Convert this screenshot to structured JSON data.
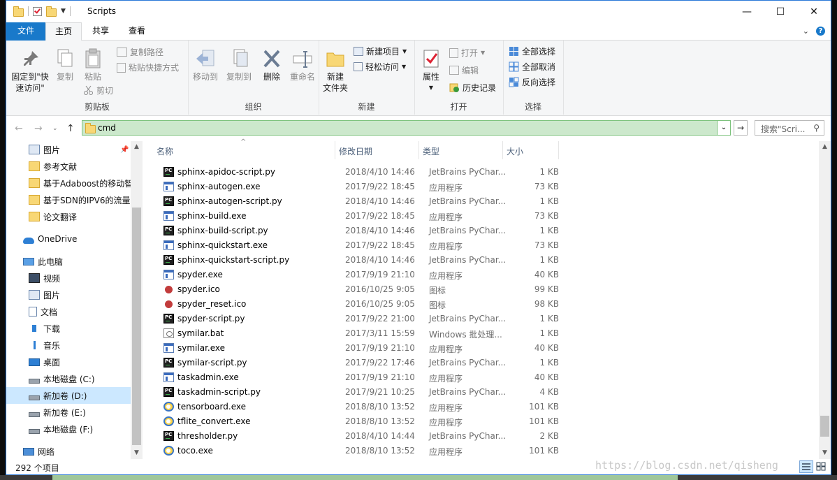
{
  "window": {
    "title": "Scripts",
    "minimize": "—",
    "maximize": "☐",
    "close": "✕"
  },
  "tabs": {
    "file": "文件",
    "home": "主页",
    "share": "共享",
    "view": "查看"
  },
  "ribbon": {
    "clipboard": {
      "name": "剪贴板",
      "pin": "固定到\"快速访问\"",
      "copy": "复制",
      "paste": "粘贴",
      "copy_path": "复制路径",
      "paste_shortcut": "粘贴快捷方式",
      "cut": "剪切"
    },
    "organize": {
      "name": "组织",
      "move_to": "移动到",
      "copy_to": "复制到",
      "delete": "删除",
      "rename": "重命名"
    },
    "new": {
      "name": "新建",
      "new_folder": "新建\n文件夹",
      "new_item": "新建项目",
      "easy_access": "轻松访问"
    },
    "open": {
      "name": "打开",
      "properties": "属性",
      "open": "打开",
      "edit": "编辑",
      "history": "历史记录"
    },
    "select": {
      "name": "选择",
      "select_all": "全部选择",
      "select_none": "全部取消",
      "invert": "反向选择"
    }
  },
  "address": {
    "path": "cmd",
    "search_placeholder": "搜索\"Scri..."
  },
  "nav": {
    "items": [
      {
        "label": "图片",
        "icon": "pictures-icon",
        "pinned": true
      },
      {
        "label": "参考文献",
        "icon": "folder-icon"
      },
      {
        "label": "基于Adaboost的移动智",
        "icon": "folder-icon"
      },
      {
        "label": "基于SDN的IPV6的流量",
        "icon": "folder-icon"
      },
      {
        "label": "论文翻译",
        "icon": "folder-icon"
      },
      {
        "label": "OneDrive",
        "icon": "onedrive-icon"
      },
      {
        "label": "此电脑",
        "icon": "computer-icon"
      },
      {
        "label": "视频",
        "icon": "videos-icon"
      },
      {
        "label": "图片",
        "icon": "pictures-icon"
      },
      {
        "label": "文档",
        "icon": "documents-icon"
      },
      {
        "label": "下载",
        "icon": "downloads-icon"
      },
      {
        "label": "音乐",
        "icon": "music-icon"
      },
      {
        "label": "桌面",
        "icon": "desktop-icon"
      },
      {
        "label": "本地磁盘 (C:)",
        "icon": "drive-icon"
      },
      {
        "label": "新加卷 (D:)",
        "icon": "drive-icon",
        "selected": true
      },
      {
        "label": "新加卷 (E:)",
        "icon": "drive-icon"
      },
      {
        "label": "本地磁盘 (F:)",
        "icon": "drive-icon"
      },
      {
        "label": "网络",
        "icon": "network-icon"
      }
    ]
  },
  "columns": {
    "name": "名称",
    "date": "修改日期",
    "type": "类型",
    "size": "大小"
  },
  "files": [
    {
      "name": "sphinx-apidoc-script.py",
      "date": "2018/4/10 14:46",
      "type": "JetBrains PyChar...",
      "size": "1 KB",
      "icon": "pycharm"
    },
    {
      "name": "sphinx-autogen.exe",
      "date": "2017/9/22 18:45",
      "type": "应用程序",
      "size": "73 KB",
      "icon": "exe"
    },
    {
      "name": "sphinx-autogen-script.py",
      "date": "2018/4/10 14:46",
      "type": "JetBrains PyChar...",
      "size": "1 KB",
      "icon": "pycharm"
    },
    {
      "name": "sphinx-build.exe",
      "date": "2017/9/22 18:45",
      "type": "应用程序",
      "size": "73 KB",
      "icon": "exe"
    },
    {
      "name": "sphinx-build-script.py",
      "date": "2018/4/10 14:46",
      "type": "JetBrains PyChar...",
      "size": "1 KB",
      "icon": "pycharm"
    },
    {
      "name": "sphinx-quickstart.exe",
      "date": "2017/9/22 18:45",
      "type": "应用程序",
      "size": "73 KB",
      "icon": "exe"
    },
    {
      "name": "sphinx-quickstart-script.py",
      "date": "2018/4/10 14:46",
      "type": "JetBrains PyChar...",
      "size": "1 KB",
      "icon": "pycharm"
    },
    {
      "name": "spyder.exe",
      "date": "2017/9/19 21:10",
      "type": "应用程序",
      "size": "40 KB",
      "icon": "exe"
    },
    {
      "name": "spyder.ico",
      "date": "2016/10/25 9:05",
      "type": "图标",
      "size": "99 KB",
      "icon": "ico"
    },
    {
      "name": "spyder_reset.ico",
      "date": "2016/10/25 9:05",
      "type": "图标",
      "size": "98 KB",
      "icon": "ico"
    },
    {
      "name": "spyder-script.py",
      "date": "2017/9/22 21:00",
      "type": "JetBrains PyChar...",
      "size": "1 KB",
      "icon": "pycharm"
    },
    {
      "name": "symilar.bat",
      "date": "2017/3/11 15:59",
      "type": "Windows 批处理...",
      "size": "1 KB",
      "icon": "bat"
    },
    {
      "name": "symilar.exe",
      "date": "2017/9/19 21:10",
      "type": "应用程序",
      "size": "40 KB",
      "icon": "exe"
    },
    {
      "name": "symilar-script.py",
      "date": "2017/9/22 17:46",
      "type": "JetBrains PyChar...",
      "size": "1 KB",
      "icon": "pycharm"
    },
    {
      "name": "taskadmin.exe",
      "date": "2017/9/19 21:10",
      "type": "应用程序",
      "size": "40 KB",
      "icon": "exe"
    },
    {
      "name": "taskadmin-script.py",
      "date": "2017/9/21 10:25",
      "type": "JetBrains PyChar...",
      "size": "4 KB",
      "icon": "pycharm"
    },
    {
      "name": "tensorboard.exe",
      "date": "2018/8/10 13:52",
      "type": "应用程序",
      "size": "101 KB",
      "icon": "tf"
    },
    {
      "name": "tflite_convert.exe",
      "date": "2018/8/10 13:52",
      "type": "应用程序",
      "size": "101 KB",
      "icon": "tf"
    },
    {
      "name": "thresholder.py",
      "date": "2018/4/10 14:44",
      "type": "JetBrains PyChar...",
      "size": "2 KB",
      "icon": "pycharm"
    },
    {
      "name": "toco.exe",
      "date": "2018/8/10 13:52",
      "type": "应用程序",
      "size": "101 KB",
      "icon": "tf"
    }
  ],
  "status": {
    "count": "292 个项目"
  },
  "watermark": "https://blog.csdn.net/qisheng"
}
